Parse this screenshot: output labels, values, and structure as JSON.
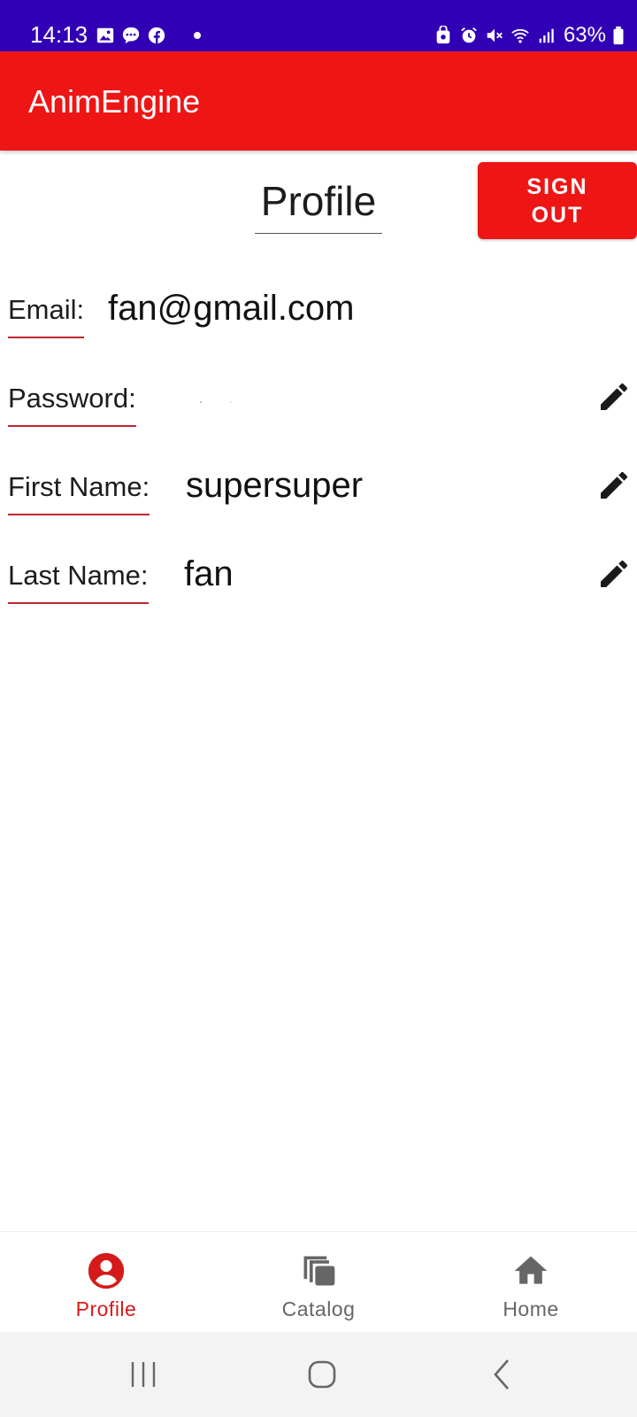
{
  "status_bar": {
    "time": "14:13",
    "battery": "63%",
    "background_color": "#3200b4",
    "left_icons": [
      "gallery-icon",
      "chat-icon",
      "facebook-icon",
      "dot-icon"
    ],
    "right_icons": [
      "privacy-icon",
      "alarm-icon",
      "mute-icon",
      "wifi-icon",
      "signal-icon",
      "battery-icon"
    ]
  },
  "app_bar": {
    "title": "AnimEngine",
    "color": "#ee1515"
  },
  "profile": {
    "title": "Profile",
    "sign_out_label": "SIGN\nOUT",
    "fields": [
      {
        "label": "Email:",
        "value": "fan@gmail.com",
        "editable": false
      },
      {
        "label": "Password:",
        "value": "",
        "editable": true
      },
      {
        "label": "First Name:",
        "value": "supersuper",
        "editable": true
      },
      {
        "label": "Last Name:",
        "value": "fan",
        "editable": true
      }
    ]
  },
  "bottom_nav": {
    "items": [
      {
        "label": "Profile",
        "icon": "account-circle-icon",
        "active": true
      },
      {
        "label": "Catalog",
        "icon": "library-icon",
        "active": false
      },
      {
        "label": "Home",
        "icon": "home-icon",
        "active": false
      }
    ],
    "active_color": "#d51a1a",
    "inactive_color": "#666666"
  },
  "system_nav": {
    "buttons": [
      "recents-icon",
      "home-circle-icon",
      "back-icon"
    ]
  }
}
